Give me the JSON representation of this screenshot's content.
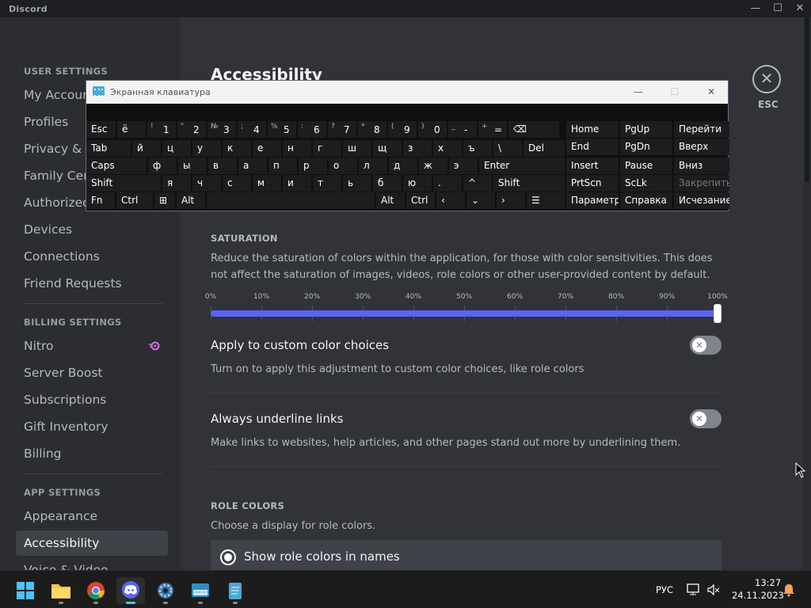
{
  "window": {
    "app_name": "Discord"
  },
  "sidebar": {
    "user_header": "USER SETTINGS",
    "billing_header": "BILLING SETTINGS",
    "app_header": "APP SETTINGS",
    "items": [
      "My Account",
      "Profiles",
      "Privacy & Safety",
      "Family Centre",
      "Authorized Apps",
      "Devices",
      "Connections",
      "Friend Requests",
      "Nitro",
      "Server Boost",
      "Subscriptions",
      "Gift Inventory",
      "Billing",
      "Appearance",
      "Accessibility",
      "Voice & Video"
    ]
  },
  "content": {
    "title": "Accessibility",
    "saturation": {
      "title": "SATURATION",
      "description": "Reduce the saturation of colors within the application, for those with color sensitivities. This does not affect the saturation of images, videos, role colors or other user-provided content by default.",
      "tick_labels": [
        "0%",
        "10%",
        "20%",
        "30%",
        "40%",
        "50%",
        "60%",
        "70%",
        "80%",
        "90%",
        "100%"
      ],
      "value_percent": 100
    },
    "custom_colors": {
      "title": "Apply to custom color choices",
      "description": "Turn on to apply this adjustment to custom color choices, like role colors",
      "enabled": false
    },
    "underline_links": {
      "title": "Always underline links",
      "description": "Make links to websites, help articles, and other pages stand out more by underlining them.",
      "enabled": false
    },
    "role_colors": {
      "title": "ROLE COLORS",
      "description": "Choose a display for role colors.",
      "option_selected": "Show role colors in names"
    },
    "close_label": "ESC"
  },
  "osk": {
    "title": "Экранная клавиатура",
    "row1": [
      [
        "Esc",
        ""
      ],
      [
        "ё",
        ""
      ],
      [
        "1",
        "!"
      ],
      [
        "2",
        "\""
      ],
      [
        "3",
        "№"
      ],
      [
        "4",
        ";"
      ],
      [
        "5",
        "%"
      ],
      [
        "6",
        ":"
      ],
      [
        "7",
        "?"
      ],
      [
        "8",
        "*"
      ],
      [
        "9",
        "("
      ],
      [
        "0",
        ")"
      ],
      [
        "-",
        "_"
      ],
      [
        "=",
        "+"
      ]
    ],
    "row2": [
      "Tab",
      "й",
      "ц",
      "у",
      "к",
      "е",
      "н",
      "г",
      "ш",
      "щ",
      "з",
      "х",
      "ъ",
      "\\",
      "Del"
    ],
    "row3": [
      "Caps",
      "ф",
      "ы",
      "в",
      "а",
      "п",
      "р",
      "о",
      "л",
      "д",
      "ж",
      "э",
      "Enter"
    ],
    "row4": [
      "Shift",
      "я",
      "ч",
      "с",
      "м",
      "и",
      "т",
      "ь",
      "б",
      "ю",
      ".",
      "Shift"
    ],
    "row5": [
      "Fn",
      "Ctrl",
      "Alt",
      "Alt",
      "Ctrl"
    ],
    "nav": [
      [
        "Home",
        "PgUp",
        "Перейти"
      ],
      [
        "End",
        "PgDn",
        "Вверх"
      ],
      [
        "Insert",
        "Pause",
        "Вниз"
      ],
      [
        "PrtScn",
        "ScLk",
        "Закрепить"
      ],
      [
        "Параметры",
        "Справка",
        "Исчезание"
      ]
    ]
  },
  "taskbar": {
    "language": "РУС",
    "time": "13:27",
    "date": "24.11.2023"
  },
  "colors": {
    "accent": "#5865f2",
    "background": "#313338",
    "sidebar": "#2b2d31"
  }
}
